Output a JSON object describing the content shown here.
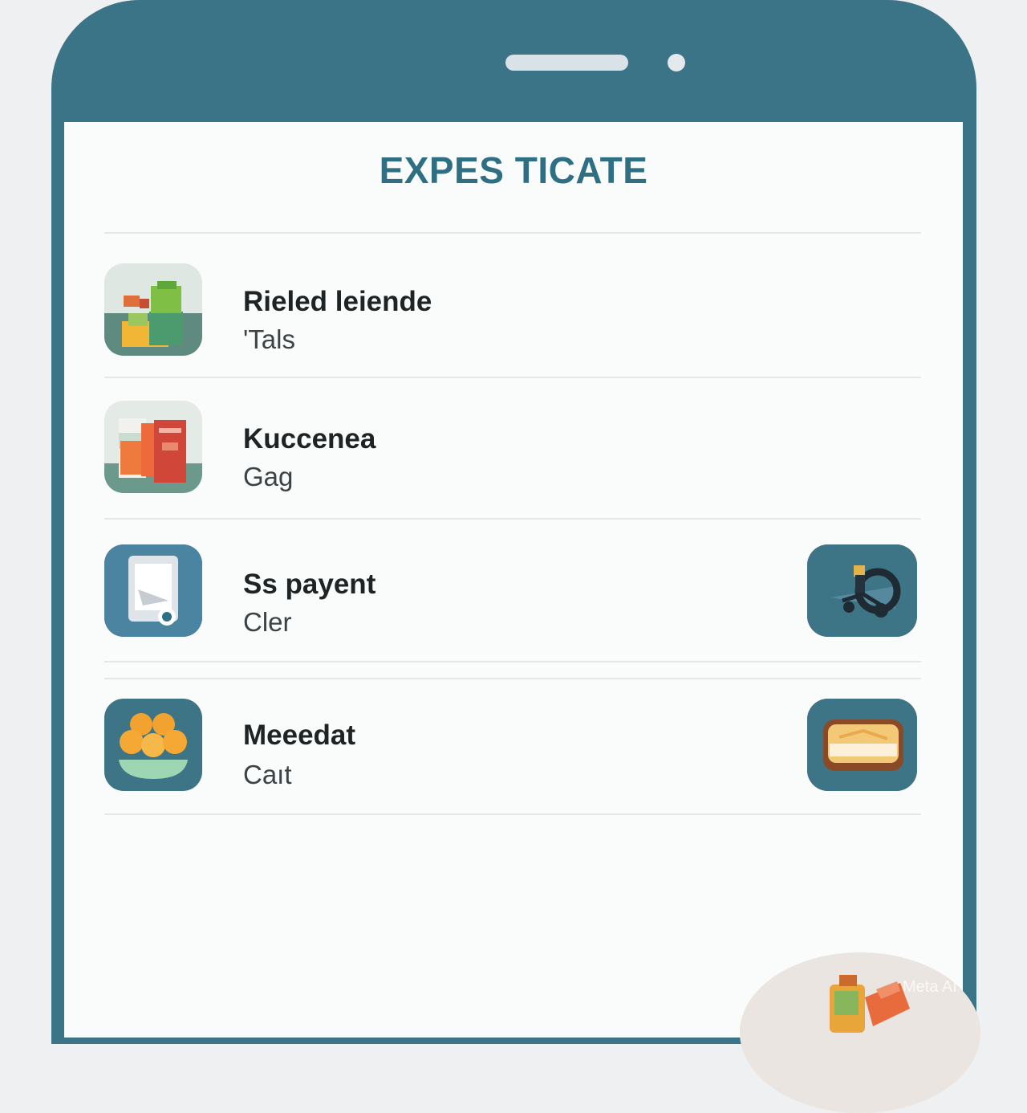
{
  "header": {
    "title": "EXPES TICATE"
  },
  "list": {
    "items": [
      {
        "title": "Rieled leiende",
        "subtitle": "'Tals",
        "icon": "groceries-box-icon"
      },
      {
        "title": "Kuccenea",
        "subtitle": "Gag",
        "icon": "pantry-items-icon"
      },
      {
        "title": "Ss payent",
        "subtitle": "Cler",
        "icon": "appliance-icon",
        "action_icon": "scooter-icon"
      },
      {
        "title": "Meeedat",
        "subtitle": "Caıt",
        "icon": "fruit-bowl-icon",
        "action_icon": "cake-slice-icon"
      }
    ]
  },
  "watermark": "Meta AI",
  "colors": {
    "frame": "#3b7387",
    "title": "#2f6f84",
    "tile": "#3d7587",
    "screen": "#fafbfb"
  }
}
